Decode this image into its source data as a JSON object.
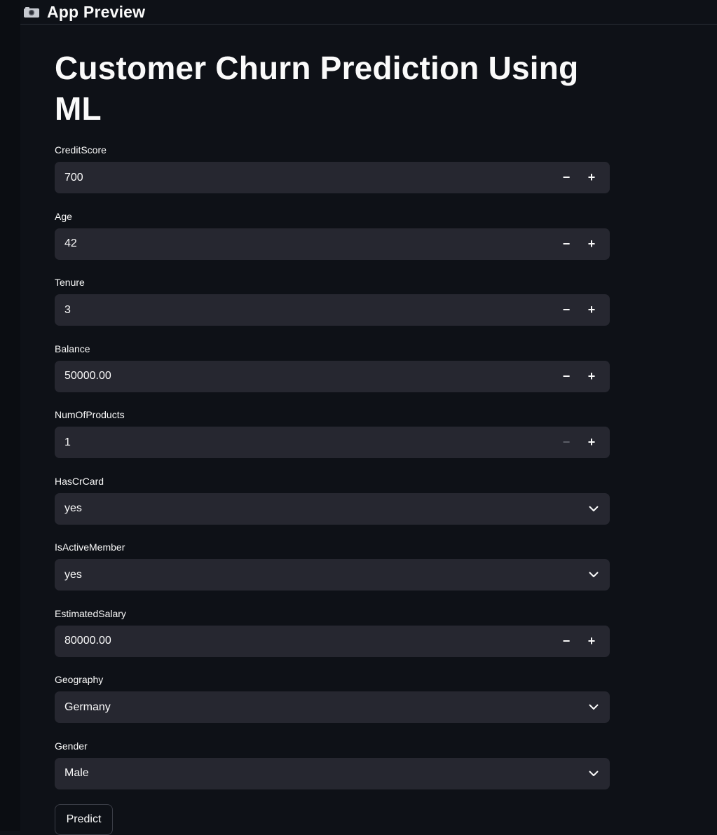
{
  "app": {
    "header_title": "App Preview",
    "header_icon": "camera-icon"
  },
  "page": {
    "title": "Customer Churn Prediction Using ML"
  },
  "fields": [
    {
      "label": "CreditScore",
      "type": "number",
      "value": "700"
    },
    {
      "label": "Age",
      "type": "number",
      "value": "42"
    },
    {
      "label": "Tenure",
      "type": "number",
      "value": "3"
    },
    {
      "label": "Balance",
      "type": "number",
      "value": "50000.00"
    },
    {
      "label": "NumOfProducts",
      "type": "number",
      "value": "1",
      "minus_disabled": true
    },
    {
      "label": "HasCrCard",
      "type": "select",
      "value": "yes"
    },
    {
      "label": "IsActiveMember",
      "type": "select",
      "value": "yes"
    },
    {
      "label": "EstimatedSalary",
      "type": "number",
      "value": "80000.00"
    },
    {
      "label": "Geography",
      "type": "select",
      "value": "Germany"
    },
    {
      "label": "Gender",
      "type": "select",
      "value": "Male"
    }
  ],
  "stepper": {
    "minus": "−",
    "plus": "+"
  },
  "actions": {
    "predict_label": "Predict"
  },
  "colors": {
    "background": "#0e1117",
    "input_background": "#262730",
    "text": "#fafafa",
    "disabled": "#5c5f68"
  }
}
